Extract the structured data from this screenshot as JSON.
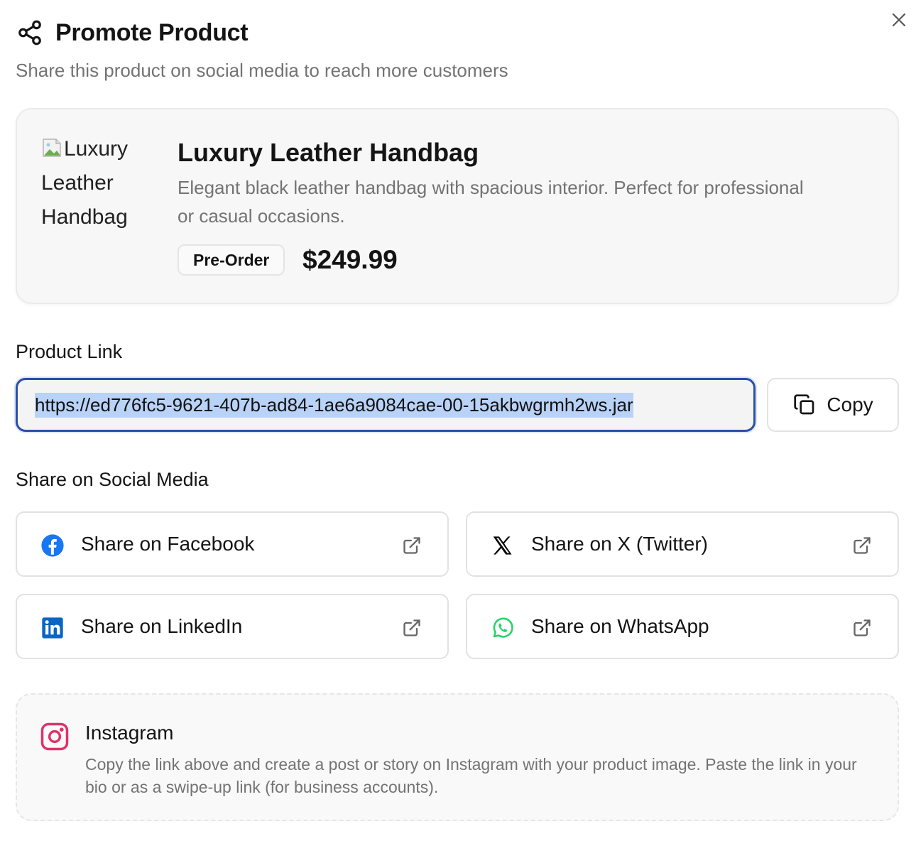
{
  "dialog": {
    "title": "Promote Product",
    "subtitle": "Share this product on social media to reach more customers",
    "close_icon": "close-icon"
  },
  "product": {
    "image_alt": "Luxury Leather Handbag",
    "name": "Luxury Leather Handbag",
    "description": "Elegant black leather handbag with spacious interior. Perfect for professional or casual occasions.",
    "badge": "Pre-Order",
    "price": "$249.99"
  },
  "link_section": {
    "label": "Product Link",
    "url": "https://ed776fc5-9621-407b-ad84-1ae6a9084cae-00-15akbwgrmh2ws.jar",
    "copy_label": "Copy"
  },
  "social_section": {
    "label": "Share on Social Media",
    "buttons": [
      {
        "label": "Share on Facebook",
        "icon": "facebook-icon",
        "color": "#1877F2"
      },
      {
        "label": "Share on X (Twitter)",
        "icon": "x-icon",
        "color": "#000000"
      },
      {
        "label": "Share on LinkedIn",
        "icon": "linkedin-icon",
        "color": "#0A66C2"
      },
      {
        "label": "Share on WhatsApp",
        "icon": "whatsapp-icon",
        "color": "#25D366"
      }
    ]
  },
  "instagram": {
    "title": "Instagram",
    "description": "Copy the link above and create a post or story on Instagram with your product image. Paste the link in your bio or as a swipe-up link (for business accounts).",
    "icon": "instagram-icon",
    "color": "#E1306C"
  }
}
